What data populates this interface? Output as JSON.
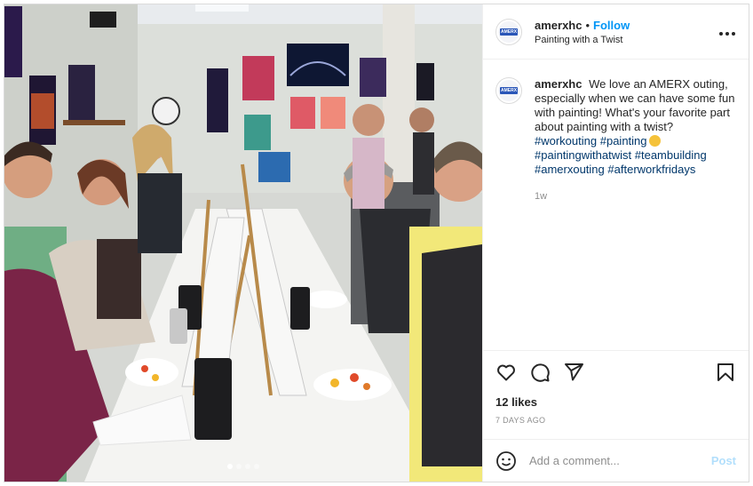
{
  "header": {
    "username": "amerxhc",
    "separator": "•",
    "follow_label": "Follow",
    "location": "Painting with a Twist",
    "avatar_text": "AMERX",
    "more_icon": "more-icon"
  },
  "caption": {
    "username": "amerxhc",
    "text": "We love an AMERX outing, especially when we can have some fun with painting! What's your favorite part about painting with a twist?",
    "hashtags": [
      "#workouting",
      "#painting",
      "#paintingwithatwist",
      "#teambuilding",
      "#amerxouting",
      "#afterworkfridays"
    ],
    "emoji": "smiley-emoji",
    "time_ago": "1w"
  },
  "actions": {
    "like_icon": "heart-icon",
    "comment_icon": "comment-icon",
    "share_icon": "share-icon",
    "save_icon": "bookmark-icon"
  },
  "likes": "12 likes",
  "date": "7 DAYS AGO",
  "comment": {
    "placeholder": "Add a comment...",
    "post_label": "Post",
    "emoji_icon": "smiley-icon"
  },
  "colors": {
    "link": "#0095f6",
    "hashtag": "#00376b",
    "muted": "#8e8e8e",
    "post_disabled": "#b2dffc",
    "border": "#dbdbdb"
  },
  "media": {
    "carousel_dots": 4,
    "active_dot": 0
  }
}
